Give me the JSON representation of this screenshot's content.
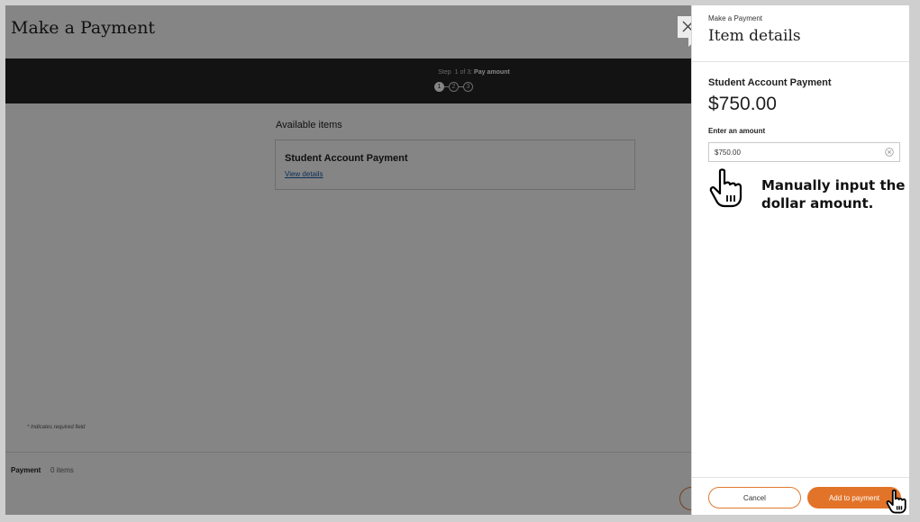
{
  "page": {
    "title": "Make a Payment",
    "step_prefix": "Step",
    "step_current": "1 of 3:",
    "step_name": "Pay amount",
    "steps": [
      "1",
      "2",
      "3"
    ],
    "available_label": "Available items",
    "item_name": "Student Account Payment",
    "view_details": "View details",
    "required_note": "* Indicates required field",
    "footer_label": "Payment",
    "footer_count": "0 items"
  },
  "panel": {
    "breadcrumb": "Make a Payment",
    "title": "Item details",
    "item_name": "Student Account Payment",
    "item_amount": "$750.00",
    "amount_label": "Enter an amount",
    "amount_value": "$750.00",
    "annotation": "Manually input the dollar amount.",
    "cancel_label": "Cancel",
    "add_label": "Add to payment"
  },
  "icons": {
    "close": "close-icon",
    "clear": "clear-circle-icon",
    "pointer": "hand-pointer-icon"
  },
  "colors": {
    "accent": "#e2742a",
    "stepbar": "#262626",
    "link": "#1a5aa8"
  }
}
